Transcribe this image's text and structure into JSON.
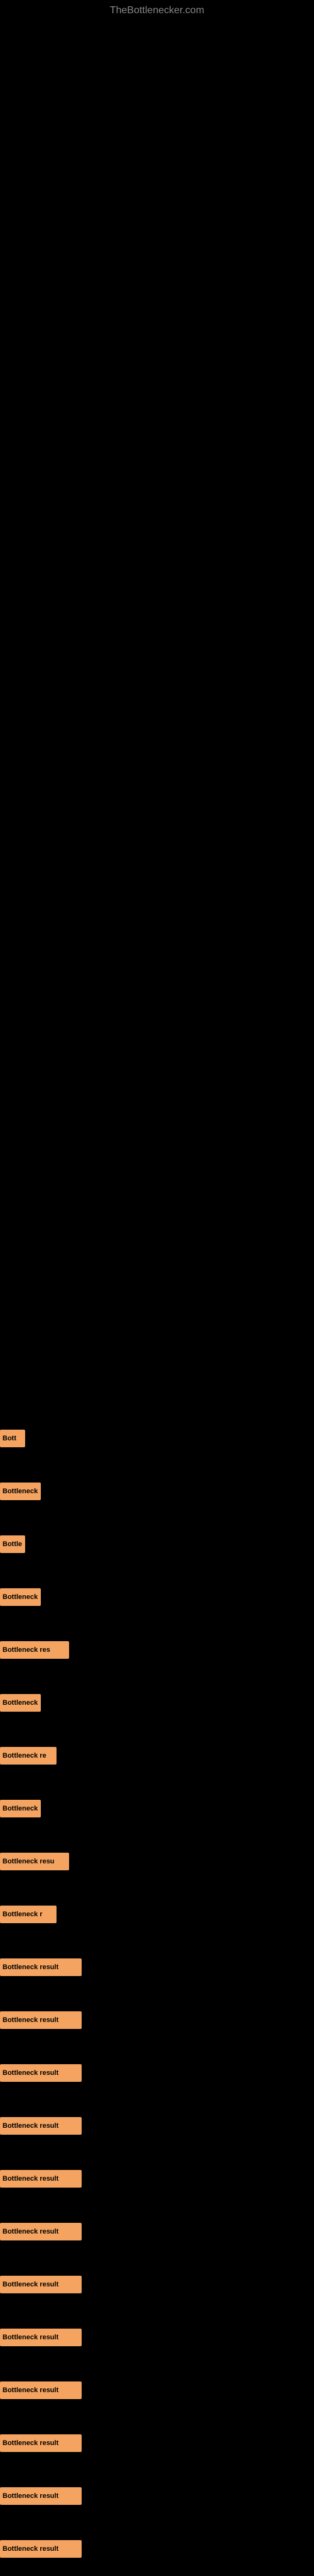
{
  "site": {
    "title": "TheBottlenecker.com"
  },
  "results": [
    {
      "id": 1,
      "label": "Bott",
      "width": "tiny"
    },
    {
      "id": 2,
      "label": "Bottleneck",
      "width": "small"
    },
    {
      "id": 3,
      "label": "Bottle",
      "width": "tiny"
    },
    {
      "id": 4,
      "label": "Bottleneck",
      "width": "small"
    },
    {
      "id": 5,
      "label": "Bottleneck res",
      "width": "larger"
    },
    {
      "id": 6,
      "label": "Bottleneck",
      "width": "small"
    },
    {
      "id": 7,
      "label": "Bottleneck re",
      "width": "medium"
    },
    {
      "id": 8,
      "label": "Bottleneck",
      "width": "small"
    },
    {
      "id": 9,
      "label": "Bottleneck resu",
      "width": "larger"
    },
    {
      "id": 10,
      "label": "Bottleneck r",
      "width": "medium"
    },
    {
      "id": 11,
      "label": "Bottleneck result",
      "width": "full"
    },
    {
      "id": 12,
      "label": "Bottleneck result",
      "width": "full"
    },
    {
      "id": 13,
      "label": "Bottleneck result",
      "width": "full"
    },
    {
      "id": 14,
      "label": "Bottleneck result",
      "width": "full"
    },
    {
      "id": 15,
      "label": "Bottleneck result",
      "width": "full"
    },
    {
      "id": 16,
      "label": "Bottleneck result",
      "width": "full"
    },
    {
      "id": 17,
      "label": "Bottleneck result",
      "width": "full"
    },
    {
      "id": 18,
      "label": "Bottleneck result",
      "width": "full"
    },
    {
      "id": 19,
      "label": "Bottleneck result",
      "width": "full"
    },
    {
      "id": 20,
      "label": "Bottleneck result",
      "width": "full"
    },
    {
      "id": 21,
      "label": "Bottleneck result",
      "width": "full"
    },
    {
      "id": 22,
      "label": "Bottleneck result",
      "width": "full"
    }
  ],
  "colors": {
    "background": "#000000",
    "bar": "#F4A460",
    "barText": "#000000",
    "siteTitle": "#888888"
  }
}
